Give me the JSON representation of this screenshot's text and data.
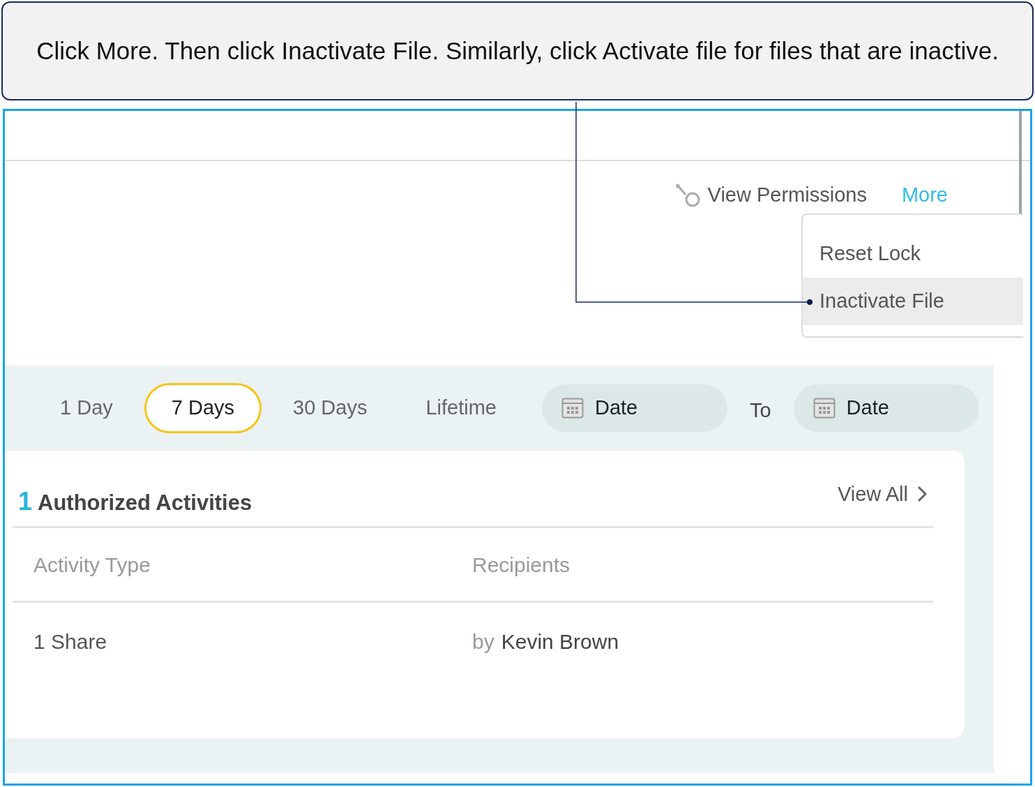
{
  "callout": {
    "text": "Click More. Then click Inactivate File. Similarly, click Activate file for files that are inactive."
  },
  "actions": {
    "view_permissions": "View Permissions",
    "more": "More"
  },
  "menu": {
    "items": [
      {
        "label": "Reset Lock",
        "selected": false
      },
      {
        "label": "Inactivate File",
        "selected": true
      }
    ]
  },
  "filters": {
    "ranges": [
      {
        "label": "1 Day",
        "selected": false
      },
      {
        "label": "7 Days",
        "selected": true
      },
      {
        "label": "30 Days",
        "selected": false
      },
      {
        "label": "Lifetime",
        "selected": false
      }
    ],
    "from": {
      "label": "Date"
    },
    "to_label": "To",
    "to": {
      "label": "Date"
    }
  },
  "activities": {
    "count": "1",
    "title": "Authorized Activities",
    "view_all": "View All",
    "columns": [
      "Activity Type",
      "Recipients"
    ],
    "rows": [
      {
        "activity": "1 Share",
        "by": "by",
        "recipient": "Kevin Brown"
      }
    ]
  }
}
